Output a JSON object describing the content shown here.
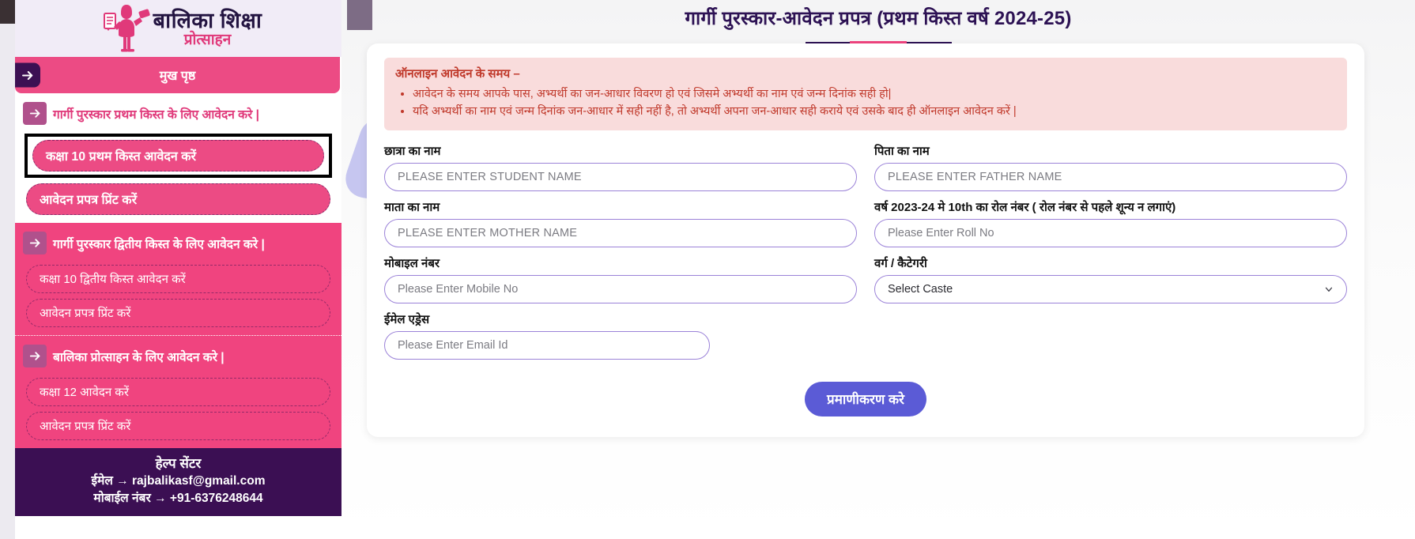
{
  "colors": {
    "pink": "#ec4b84",
    "pink_strong": "#f0447f",
    "purple_dark": "#3b0f53",
    "title_purple": "#2d1254",
    "input_border": "#9b82d8",
    "submit_blue": "#5b5bd6",
    "notice_bg": "#f9dcdc",
    "notice_text": "#c0392b"
  },
  "sidebar": {
    "logo": {
      "line1": "बालिका  शिक्षा",
      "line2": "प्रोत्साहन",
      "icon": "girl-with-certificate-icon"
    },
    "home": {
      "label": "मुख पृष्ठ",
      "icon": "arrow-right-icon"
    },
    "groups": [
      {
        "heading": "गार्गी पुरस्कार प्रथम किस्त के लिए आवेदन करे |",
        "icon": "arrow-right-icon",
        "style": "white",
        "items": [
          {
            "label": "कक्षा 10 प्रथम किस्त आवेदन करें",
            "highlighted": true
          },
          {
            "label": "आवेदन प्रपत्र प्रिंट करें",
            "highlighted": false
          }
        ]
      },
      {
        "heading": "गार्गी पुरस्कार द्वितीय किस्त के लिए आवेदन करे |",
        "icon": "arrow-right-icon",
        "style": "pink",
        "items": [
          {
            "label": "कक्षा 10 द्वितीय किस्त आवेदन करें",
            "highlighted": false
          },
          {
            "label": "आवेदन प्रपत्र प्रिंट करें",
            "highlighted": false
          }
        ]
      },
      {
        "heading": "बालिका प्रोत्साहन के लिए आवेदन करे |",
        "icon": "arrow-right-icon",
        "style": "pink",
        "items": [
          {
            "label": "कक्षा 12 आवेदन करें",
            "highlighted": false
          },
          {
            "label": "आवेदन प्रपत्र प्रिंट करें",
            "highlighted": false
          }
        ]
      }
    ],
    "help": {
      "title": "हेल्प सेंटर",
      "email_line": "ईमेल → rajbalikasf@gmail.com",
      "mobile_line": "मोबाईल नंबर → +91-6376248644"
    }
  },
  "main": {
    "page_title": "गार्गी पुरस्कार-आवेदन प्रपत्र (प्रथम किस्त वर्ष 2024-25)",
    "notice": {
      "title": "ऑनलाइन आवेदन के समय –",
      "bullets": [
        "आवेदन के समय आपके पास, अभ्यर्थी का जन-आधार विवरण हो एवं जिसमे अभ्यर्थी का नाम एवं जन्म दिनांक सही हो|",
        "यदि अभ्यर्थी का नाम एवं जन्म दिनांक जन-आधार में सही नहीं है, तो अभ्यर्थी अपना जन-आधार सही कराये एवं उसके बाद ही ऑनलाइन आवेदन करें |"
      ]
    },
    "fields": {
      "student_name": {
        "label": "छात्रा का नाम",
        "placeholder": "PLEASE ENTER STUDENT NAME",
        "value": ""
      },
      "father_name": {
        "label": "पिता का नाम",
        "placeholder": "PLEASE ENTER FATHER NAME",
        "value": ""
      },
      "mother_name": {
        "label": "माता का नाम",
        "placeholder": "PLEASE ENTER MOTHER NAME",
        "value": ""
      },
      "roll_no": {
        "label": "वर्ष 2023-24 मे 10th का रोल नंबर ( रोल नंबर से पहले शून्य न लगाएं)",
        "placeholder": "Please Enter Roll No",
        "value": ""
      },
      "mobile": {
        "label": "मोबाइल नंबर",
        "placeholder": "Please Enter Mobile No",
        "value": ""
      },
      "caste": {
        "label": "वर्ग / कैटेगरी",
        "selected": "Select Caste",
        "options": [
          "Select Caste"
        ],
        "icon": "chevron-down-icon"
      },
      "email": {
        "label": "ईमेल एड्रेस",
        "placeholder": "Please Enter Email Id",
        "value": ""
      }
    },
    "submit_label": "प्रमाणीकरण करे"
  }
}
